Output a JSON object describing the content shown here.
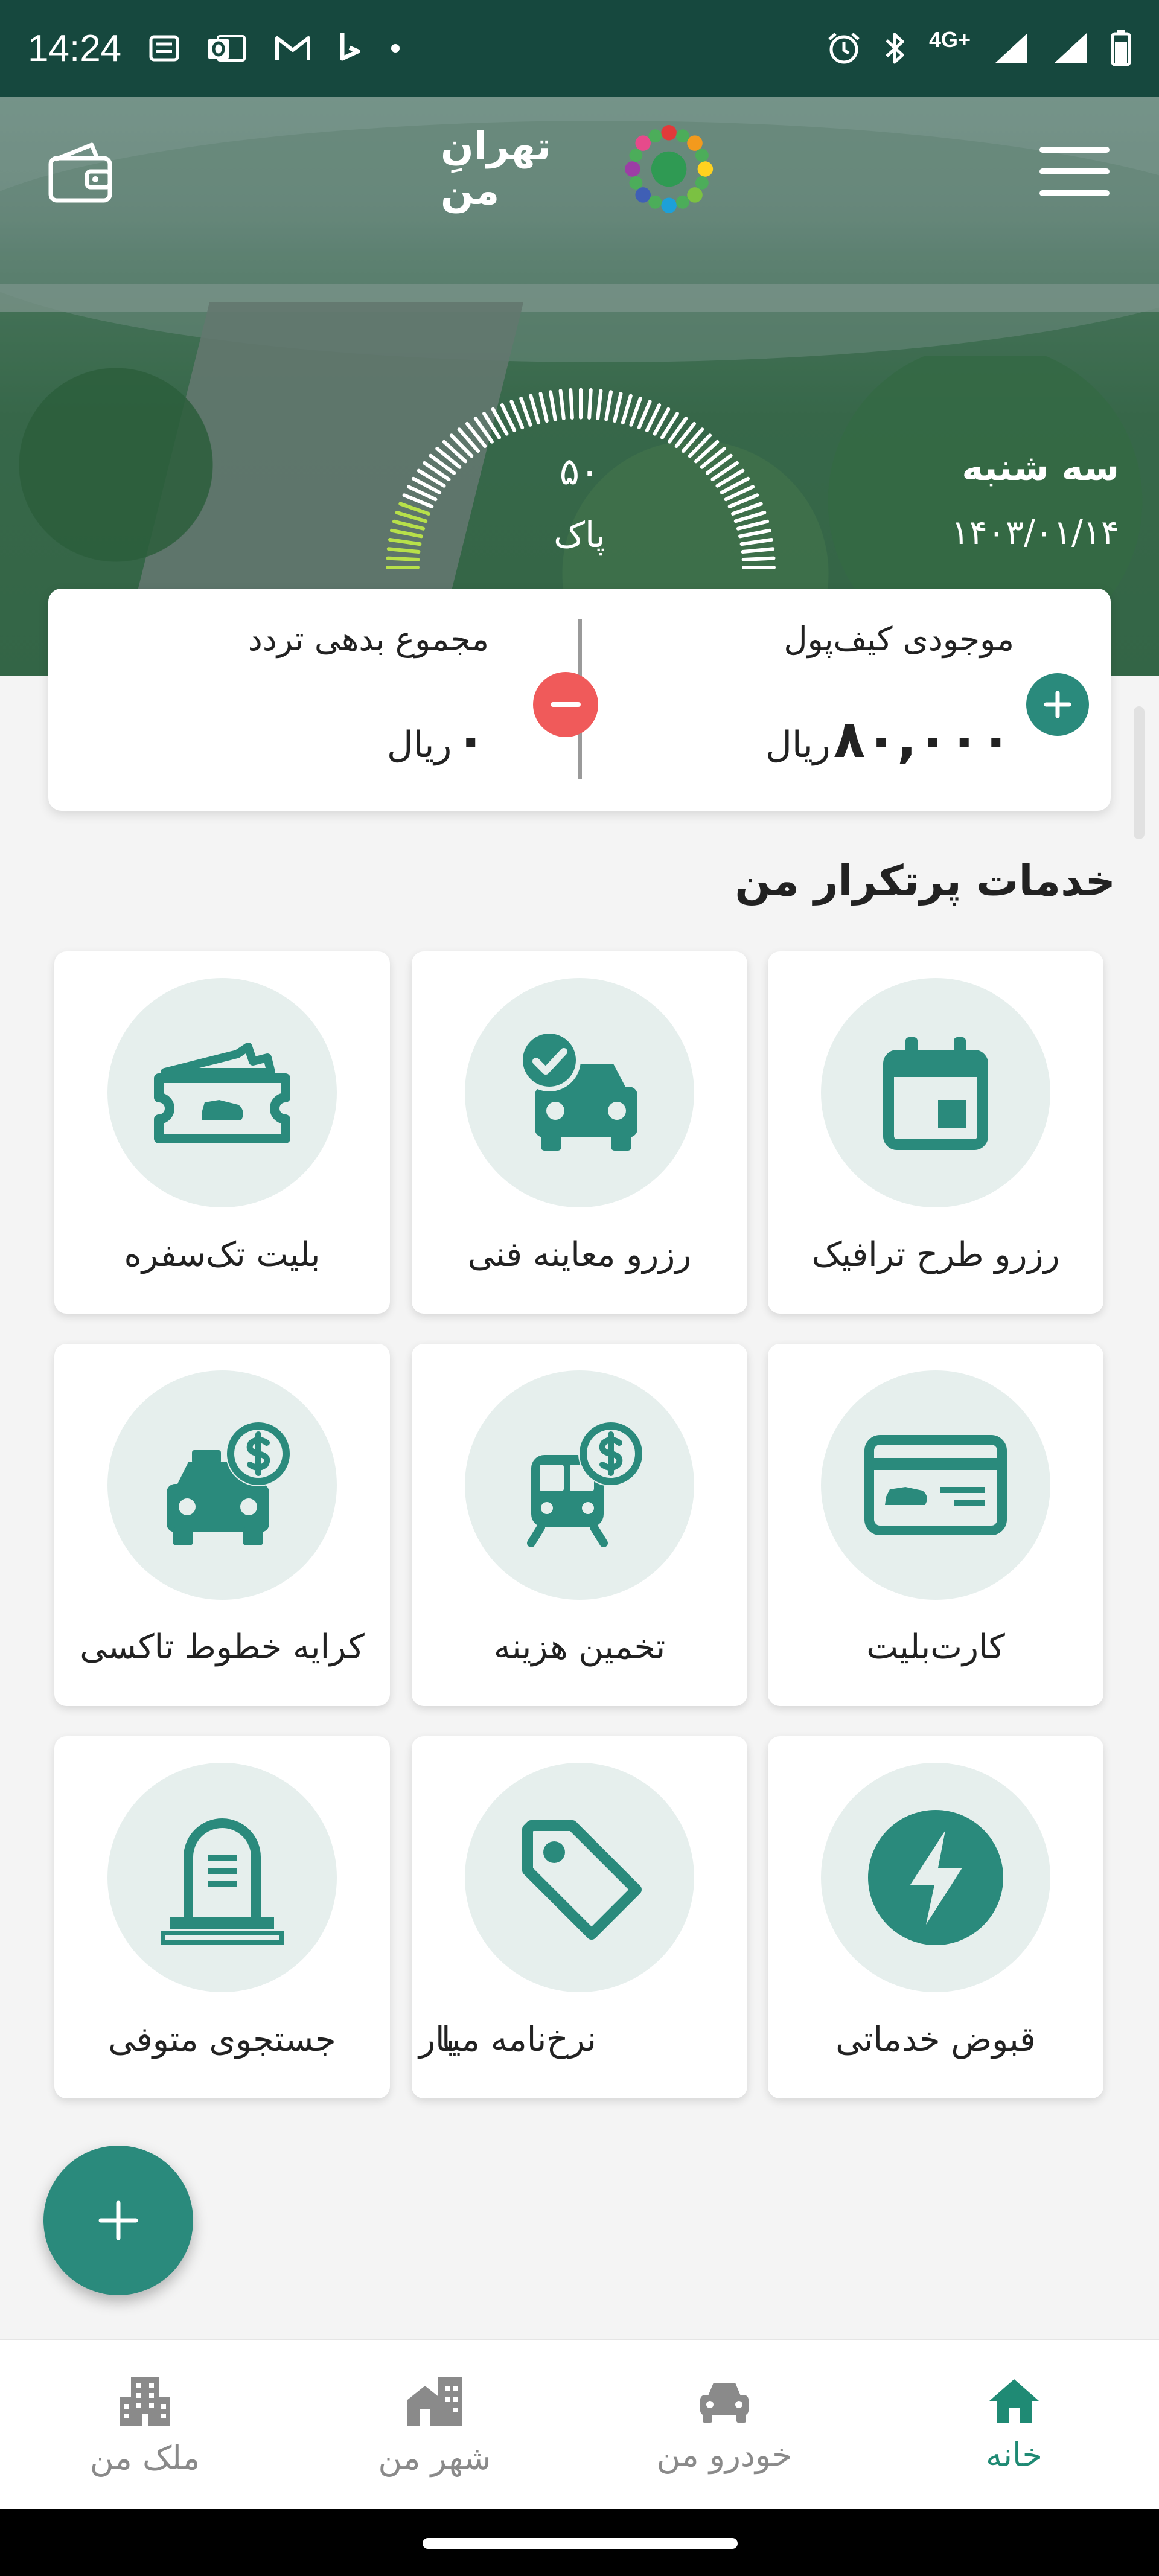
{
  "status_bar": {
    "time": "14:24",
    "network": "4G+"
  },
  "header": {
    "logo_text": "تهرانِ من",
    "day": "سه شنبه",
    "date": "۱۴۰۳/۰۱/۱۴"
  },
  "air_quality": {
    "value": "۵۰",
    "label": "پاک"
  },
  "balance": {
    "wallet_title": "موجودی کیف‌پول",
    "wallet_amount": "۸۰,۰۰۰",
    "currency": "ریال",
    "debt_title": "مجموع بدهی تردد",
    "debt_amount": "۰"
  },
  "services": {
    "title": "خدمات پرتکرار من",
    "items": [
      {
        "label": "رزرو طرح ترافیک",
        "icon": "calendar-icon"
      },
      {
        "label": "رزرو معاینه فنی",
        "icon": "car-check-icon"
      },
      {
        "label": "بلیت تک‌سفره",
        "icon": "ticket-icon"
      },
      {
        "label": "کارت‌بلیت",
        "icon": "ticket-card-icon"
      },
      {
        "label": "تخمین هزینه",
        "icon": "train-money-icon"
      },
      {
        "label": "کرایه خطوط تاکسی",
        "icon": "taxi-money-icon"
      },
      {
        "label": "قبوض خدماتی",
        "icon": "lightning-icon"
      },
      {
        "label": "نرخ‌نامه میا",
        "label_overflow": "بار",
        "icon": "tag-icon"
      },
      {
        "label": "جستجوی متوفی",
        "icon": "tombstone-icon"
      }
    ]
  },
  "bottom_nav": [
    {
      "label": "خانه",
      "icon": "home-icon",
      "active": true
    },
    {
      "label": "خودرو من",
      "icon": "car-icon",
      "active": false
    },
    {
      "label": "شهر من",
      "icon": "city-icon",
      "active": false
    },
    {
      "label": "ملک من",
      "icon": "building-icon",
      "active": false
    }
  ],
  "colors": {
    "primary": "#2a8a7c",
    "status_bar": "#16483e",
    "danger": "#f05a5a",
    "nav_active": "#1f8a74"
  }
}
